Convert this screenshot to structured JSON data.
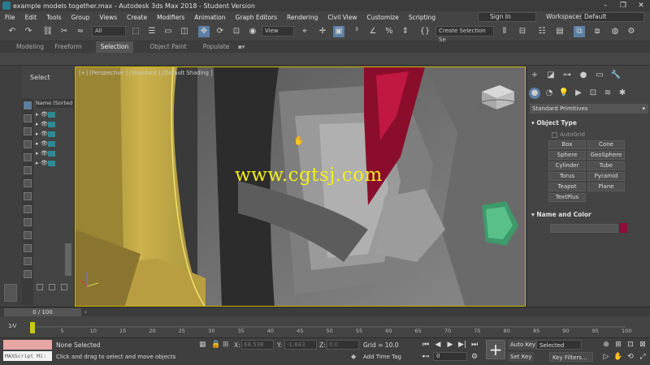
{
  "window": {
    "title": "example models together.max - Autodesk 3ds Max 2018 - Student Version",
    "controls": [
      "–",
      "❐",
      "✕"
    ]
  },
  "menu": [
    "File",
    "Edit",
    "Tools",
    "Group",
    "Views",
    "Create",
    "Modifiers",
    "Animation",
    "Graph Editors",
    "Rendering",
    "Civil View",
    "Customize",
    "Scripting"
  ],
  "sign_in": "Sign In",
  "workspaces": {
    "label": "Workspaces:",
    "value": "Default"
  },
  "toolbar": {
    "filter": "All",
    "view": "View",
    "selection_set": "Create Selection Se"
  },
  "ribbon_tabs": [
    "Modeling",
    "Freeform",
    "Selection",
    "Object Paint",
    "Populate"
  ],
  "ribbon_active": "Selection",
  "explorer": {
    "title": "Select",
    "column": "Name (Sorted A",
    "rows": 7
  },
  "viewport": {
    "label": "[+] [Perspective ] [Standard ] [Default Shading ]",
    "watermark": "www.cgtsj.com",
    "colors": {
      "yellow": "#d1b850",
      "red": "#a01030",
      "gray": "#6e6e6e"
    }
  },
  "command_panel": {
    "category": "Standard Primitives",
    "object_type_title": "Object Type",
    "autogrid": "AutoGrid",
    "primitives": [
      "Box",
      "Cone",
      "Sphere",
      "GeoSphere",
      "Cylinder",
      "Tube",
      "Torus",
      "Pyramid",
      "Teapot",
      "Plane",
      "TextPlus"
    ],
    "name_color_title": "Name and Color",
    "object_color": "#8b0f3a"
  },
  "timeline": {
    "frame_counter": "0 / 100",
    "ticks": [
      "0",
      "5",
      "10",
      "15",
      "20",
      "25",
      "30",
      "35",
      "40",
      "45",
      "50",
      "55",
      "60",
      "65",
      "70",
      "75",
      "80",
      "85",
      "90",
      "95",
      "100"
    ]
  },
  "status": {
    "maxscript": "MAXScript Mi:",
    "selection": "None Selected",
    "prompt": "Click and drag to select and move objects",
    "x_label": "X:",
    "x_value": "68.538",
    "y_label": "Y:",
    "y_value": "-1.643",
    "z_label": "Z:",
    "z_value": "0.0",
    "grid": "Grid = 10.0",
    "add_time_tag": "Add Time Tag",
    "auto_key": "Auto Key",
    "set_key": "Set Key",
    "key_mode": "Selected",
    "key_filters": "Key Filters...",
    "frame": "0"
  }
}
